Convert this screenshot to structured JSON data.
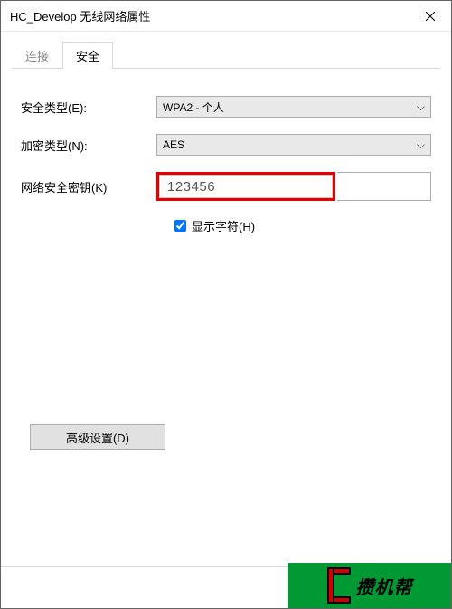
{
  "window": {
    "title": "HC_Develop 无线网络属性"
  },
  "tabs": {
    "connection": "连接",
    "security": "安全"
  },
  "fields": {
    "security_type_label": "安全类型(E):",
    "security_type_value": "WPA2 - 个人",
    "encryption_type_label": "加密类型(N):",
    "encryption_type_value": "AES",
    "network_key_label": "网络安全密钥(K)",
    "network_key_value": "123456",
    "show_chars_label": "显示字符(H)",
    "show_chars_checked": true
  },
  "buttons": {
    "advanced": "高级设置(D)",
    "ok": ""
  },
  "watermark": {
    "text": "攒机帮"
  }
}
